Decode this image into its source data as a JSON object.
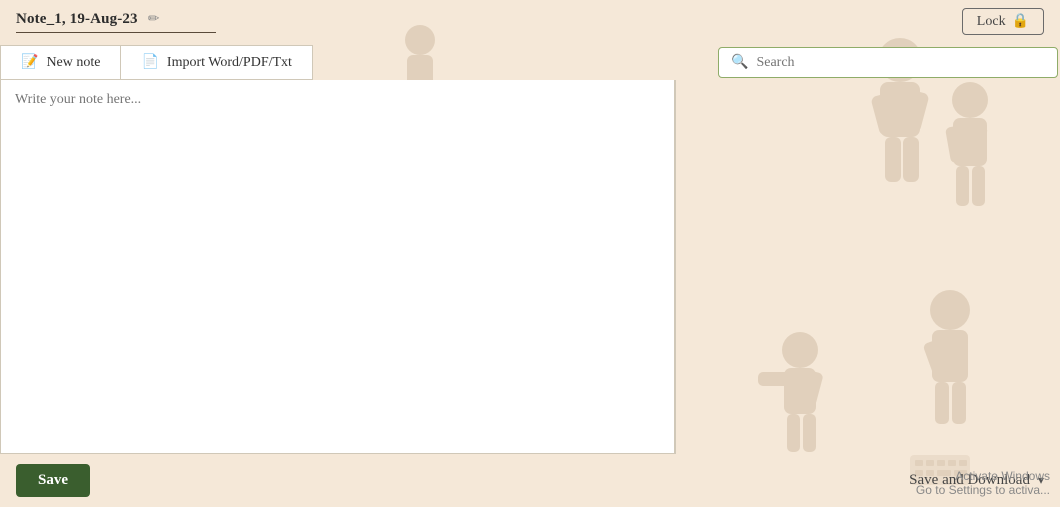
{
  "header": {
    "note_title": "Note_1, 19-Aug-23",
    "lock_label": "Lock"
  },
  "toolbar": {
    "new_note_label": "New note",
    "import_label": "Import Word/PDF/Txt",
    "search_placeholder": "Search"
  },
  "editor": {
    "placeholder": "Write your note here..."
  },
  "footer": {
    "save_label": "Save",
    "save_download_label": "Save and Download"
  },
  "watermark": {
    "line1": "Activate Windows",
    "line2": "Go to Settings to activa..."
  },
  "icons": {
    "edit": "✏",
    "lock": "🔒",
    "new_note": "📝",
    "import": "📄",
    "search": "🔍",
    "chevron_down": "▾"
  }
}
